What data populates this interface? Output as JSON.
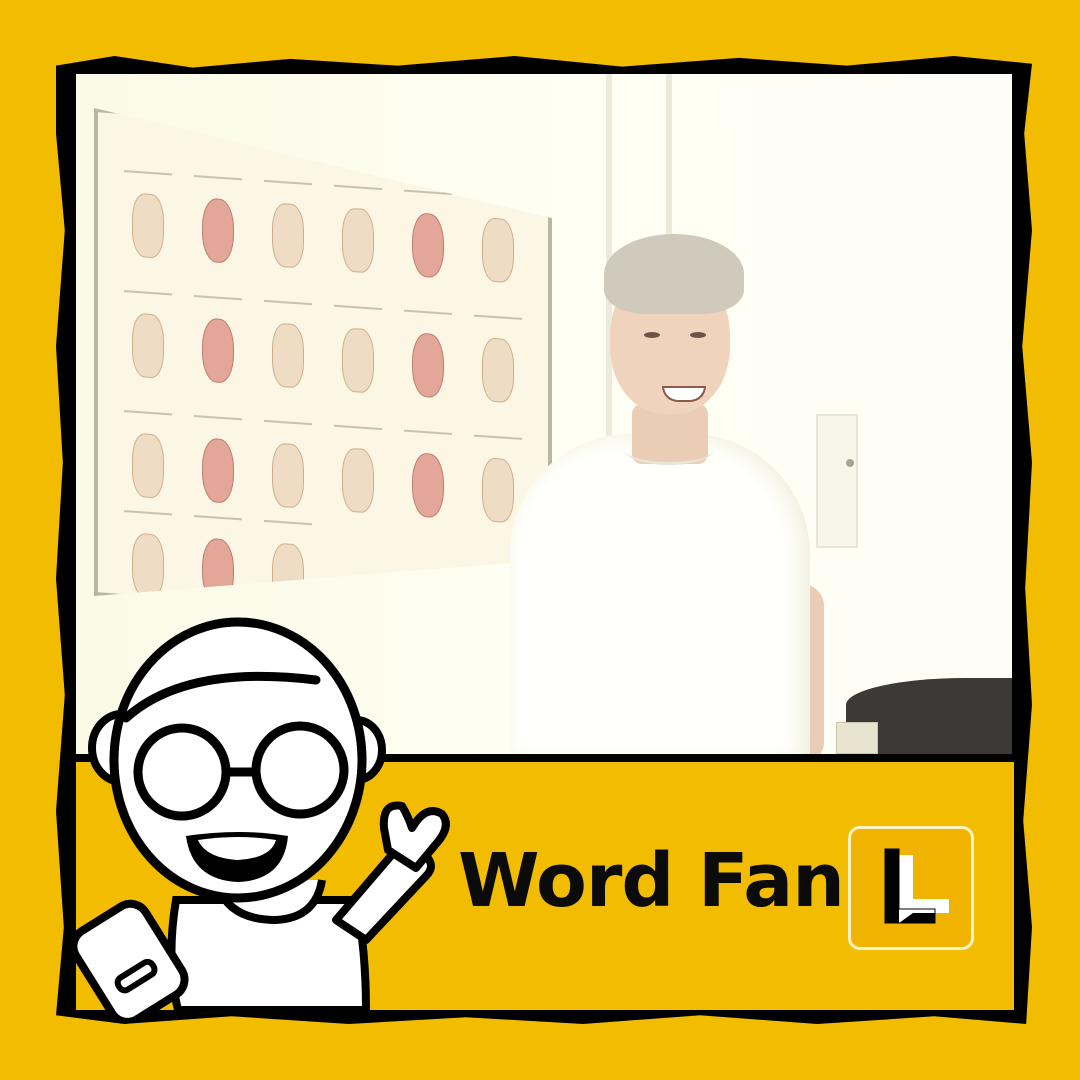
{
  "brand": {
    "name": "Word Fan",
    "logo_icon": "word-fan-logo-l-icon"
  },
  "mascot": {
    "icon": "cartoon-waving-character-icon"
  },
  "photo": {
    "subject": "man-in-white-t-shirt",
    "background_item": "anatomy-poster"
  },
  "colors": {
    "background": "#f2bc00",
    "frame": "#000000",
    "text": "#0b0b0b",
    "logo_tile": "#f0b400"
  }
}
